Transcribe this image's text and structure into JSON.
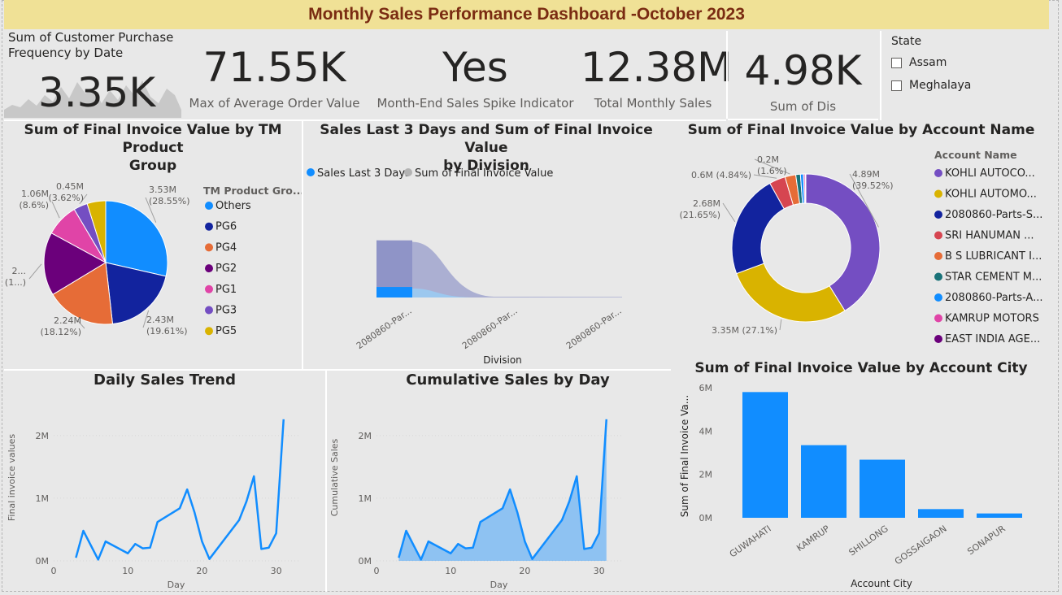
{
  "title": "Monthly Sales Performance Dashboard -October 2023",
  "kpis": {
    "purchase_freq": {
      "label_line1": "Sum of Customer Purchase",
      "label_line2": "Frequency by Date",
      "value": "3.35K"
    },
    "avg_order": {
      "value": "71.55K",
      "label": "Max of Average Order Value"
    },
    "spike": {
      "value": "Yes",
      "label": "Month-End Sales Spike Indicator"
    },
    "total_sales": {
      "value": "12.38M",
      "label": "Total Monthly Sales"
    },
    "dis": {
      "value": "4.98K",
      "label": "Sum of Dis"
    }
  },
  "slicer": {
    "title": "State",
    "options": [
      "Assam",
      "Meghalaya"
    ]
  },
  "colors": {
    "blue": "#118dff",
    "navy": "#12239e",
    "orange": "#e66c37",
    "purple": "#6b007b",
    "magenta": "#e044a7",
    "violet": "#744ec2",
    "gold": "#d9b300",
    "red": "#d64550",
    "teal": "#197278",
    "title_bar": "#f0e196",
    "title_text": "#7a2c12"
  },
  "chart_data": [
    {
      "type": "pie",
      "title_line1": "Sum of Final Invoice Value by TM Product",
      "title_line2": "Group",
      "legend_title": "TM Product Gro...",
      "labels": [
        "Others",
        "PG6",
        "PG4",
        "PG2",
        "PG1",
        "PG3",
        "PG5"
      ],
      "values": [
        3.53,
        2.43,
        2.24,
        2.05,
        1.06,
        0.45,
        0.6
      ],
      "data_labels": [
        [
          "3.53M",
          "(28.55%)"
        ],
        [
          "2.43M",
          "(19.61%)"
        ],
        [
          "2.24M",
          "(18.12%)"
        ],
        [
          "2...",
          "(1...)"
        ],
        [
          "1.06M",
          "(8.6%)"
        ],
        [
          "0.45M",
          "(3.62%)"
        ],
        [
          "",
          ""
        ]
      ],
      "colors": [
        "#118dff",
        "#12239e",
        "#e66c37",
        "#6b007b",
        "#e044a7",
        "#744ec2",
        "#d9b300"
      ]
    },
    {
      "type": "area",
      "title_line1": "Sales Last 3 Days and Sum of Final Invoice Value",
      "title_line2": "by Division",
      "legend": [
        "Sales Last 3 Days",
        "Sum of Final Invoice Value"
      ],
      "categories": [
        "2080860-Par...",
        "2080860-Par...",
        "2080860-Par..."
      ],
      "xlabel": "Division",
      "series": [
        {
          "name": "Sales Last 3 Days",
          "values": [
            0.35,
            0.3,
            0.0
          ]
        },
        {
          "name": "Sum of Final Invoice Value",
          "values": [
            1.9,
            1.85,
            0.02
          ]
        }
      ]
    },
    {
      "type": "pie",
      "donut": true,
      "title": "Sum of Final Invoice Value by Account Name",
      "legend_title": "Account Name",
      "labels": [
        "KOHLI AUTOCO...",
        "KOHLI AUTOMO...",
        "2080860-Parts-S...",
        "SRI HANUMAN ...",
        "B S LUBRICANT I...",
        "STAR CEMENT M...",
        "2080860-Parts-A...",
        "KAMRUP MOTORS",
        "EAST INDIA AGE..."
      ],
      "values": [
        4.89,
        3.35,
        2.68,
        0.42,
        0.28,
        0.12,
        0.08,
        0.04,
        0.02
      ],
      "data_labels": [
        [
          "4.89M",
          "(39.52%)"
        ],
        [
          "3.35M (27.1%)",
          ""
        ],
        [
          "2.68M",
          "(21.65%)"
        ],
        [
          "0.6M (4.84%)",
          ""
        ],
        [
          "0.2M",
          "(1.6%)"
        ]
      ],
      "colors": [
        "#744ec2",
        "#d9b300",
        "#12239e",
        "#d64550",
        "#e66c37",
        "#197278",
        "#118dff",
        "#e044a7",
        "#6b007b"
      ]
    },
    {
      "type": "line",
      "title": "Daily Sales Trend",
      "xlabel": "Day",
      "ylabel": "Final invoice values",
      "xlim": [
        0,
        33
      ],
      "ylim": [
        0,
        2400000
      ],
      "xticks": [
        "0",
        "10",
        "20",
        "30"
      ],
      "yticks": [
        "0M",
        "1M",
        "2M"
      ],
      "x": [
        3,
        4,
        6,
        7,
        10,
        11,
        12,
        13,
        14,
        17,
        18,
        19,
        20,
        21,
        25,
        26,
        27,
        28,
        29,
        30,
        31
      ],
      "y": [
        50000,
        480000,
        20000,
        310000,
        120000,
        270000,
        200000,
        210000,
        620000,
        840000,
        1140000,
        770000,
        310000,
        30000,
        650000,
        950000,
        1350000,
        190000,
        210000,
        440000,
        2260000
      ]
    },
    {
      "type": "area",
      "title": "Cumulative Sales by Day",
      "xlabel": "Day",
      "ylabel": "Cumulative Sales",
      "xlim": [
        0,
        33
      ],
      "ylim": [
        0,
        2400000
      ],
      "xticks": [
        "0",
        "10",
        "20",
        "30"
      ],
      "yticks": [
        "0M",
        "1M",
        "2M"
      ],
      "x": [
        3,
        4,
        6,
        7,
        10,
        11,
        12,
        13,
        14,
        17,
        18,
        19,
        20,
        21,
        25,
        26,
        27,
        28,
        29,
        30,
        31
      ],
      "y": [
        50000,
        480000,
        20000,
        310000,
        120000,
        270000,
        200000,
        210000,
        620000,
        840000,
        1140000,
        770000,
        310000,
        30000,
        650000,
        950000,
        1350000,
        190000,
        210000,
        440000,
        2260000
      ]
    },
    {
      "type": "bar",
      "title": "Sum of Final Invoice Value by Account City",
      "xlabel": "Account City",
      "ylabel": "Sum of Final Invoice Va...",
      "categories": [
        "GUWAHATI",
        "KAMRUP",
        "SHILLONG",
        "GOSSAIGAON",
        "SONAPUR"
      ],
      "values": [
        5800000,
        3350000,
        2680000,
        400000,
        200000
      ],
      "ylim": [
        0,
        6000000
      ],
      "yticks": [
        "0M",
        "2M",
        "4M",
        "6M"
      ]
    }
  ]
}
